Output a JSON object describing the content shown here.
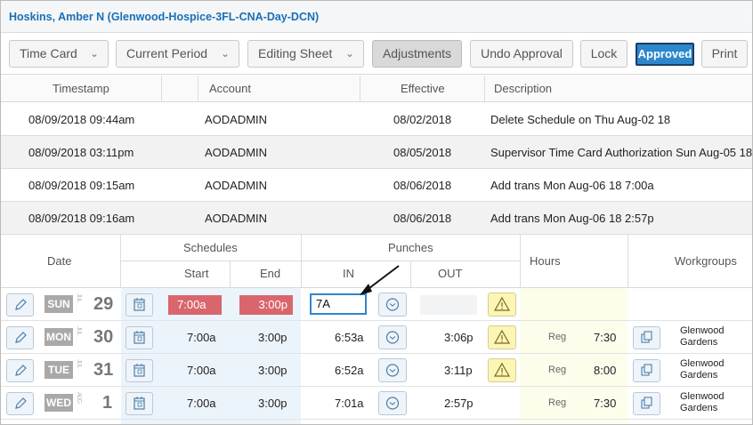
{
  "employee": {
    "name": "Hoskins, Amber N (Glenwood-Hospice-3FL-CNA-Day-DCN)"
  },
  "toolbar": {
    "time_card": "Time Card",
    "current_period": "Current Period",
    "editing_sheet": "Editing Sheet",
    "adjustments": "Adjustments",
    "undo_approval": "Undo Approval",
    "lock": "Lock",
    "approved": "Approved",
    "print": "Print"
  },
  "audit": {
    "headers": {
      "timestamp": "Timestamp",
      "account": "Account",
      "effective": "Effective",
      "description": "Description"
    },
    "rows": [
      {
        "timestamp": "08/09/2018 09:44am",
        "account": "AODADMIN",
        "effective": "08/02/2018",
        "description": "Delete Schedule on Thu Aug-02 18"
      },
      {
        "timestamp": "08/09/2018 03:11pm",
        "account": "AODADMIN",
        "effective": "08/05/2018",
        "description": "Supervisor Time Card Authorization Sun Aug-05 18"
      },
      {
        "timestamp": "08/09/2018 09:15am",
        "account": "AODADMIN",
        "effective": "08/06/2018",
        "description": "Add trans Mon Aug-06 18 7:00a"
      },
      {
        "timestamp": "08/09/2018 09:16am",
        "account": "AODADMIN",
        "effective": "08/06/2018",
        "description": "Add trans Mon Aug-06 18 2:57p"
      }
    ]
  },
  "timecard": {
    "headers": {
      "date": "Date",
      "schedules": "Schedules",
      "start": "Start",
      "end": "End",
      "punches": "Punches",
      "in": "IN",
      "out": "OUT",
      "hours": "Hours",
      "workgroups": "Workgroups"
    },
    "rows": [
      {
        "dow": "SUN",
        "month": "JUL",
        "day": "29",
        "start": "7:00a",
        "end": "3:00p",
        "in": "7A",
        "out": "",
        "hours_type": "",
        "hours": "",
        "wg1": "",
        "wg2": ""
      },
      {
        "dow": "MON",
        "month": "JUL",
        "day": "30",
        "start": "7:00a",
        "end": "3:00p",
        "in": "6:53a",
        "out": "3:06p",
        "hours_type": "Reg",
        "hours": "7:30",
        "wg1": "Glenwood",
        "wg2": "Gardens"
      },
      {
        "dow": "TUE",
        "month": "JUL",
        "day": "31",
        "start": "7:00a",
        "end": "3:00p",
        "in": "6:52a",
        "out": "3:11p",
        "hours_type": "Reg",
        "hours": "8:00",
        "wg1": "Glenwood",
        "wg2": "Gardens"
      },
      {
        "dow": "WED",
        "month": "AUG",
        "day": "1",
        "start": "7:00a",
        "end": "3:00p",
        "in": "7:01a",
        "out": "2:57p",
        "hours_type": "Reg",
        "hours": "7:30",
        "wg1": "Glenwood",
        "wg2": "Gardens"
      }
    ]
  },
  "icons": {
    "edit": "pencil-icon",
    "calendar": "calendar-icon",
    "clock": "clock-icon",
    "warning": "warning-icon",
    "copy": "copy-icon",
    "chevron": "chevron-down-icon"
  },
  "colors": {
    "accent": "#2d87cd",
    "sched_red": "#d9666c",
    "warn_yellow": "#fbf5b6",
    "name_blue": "#1a6fb5"
  }
}
